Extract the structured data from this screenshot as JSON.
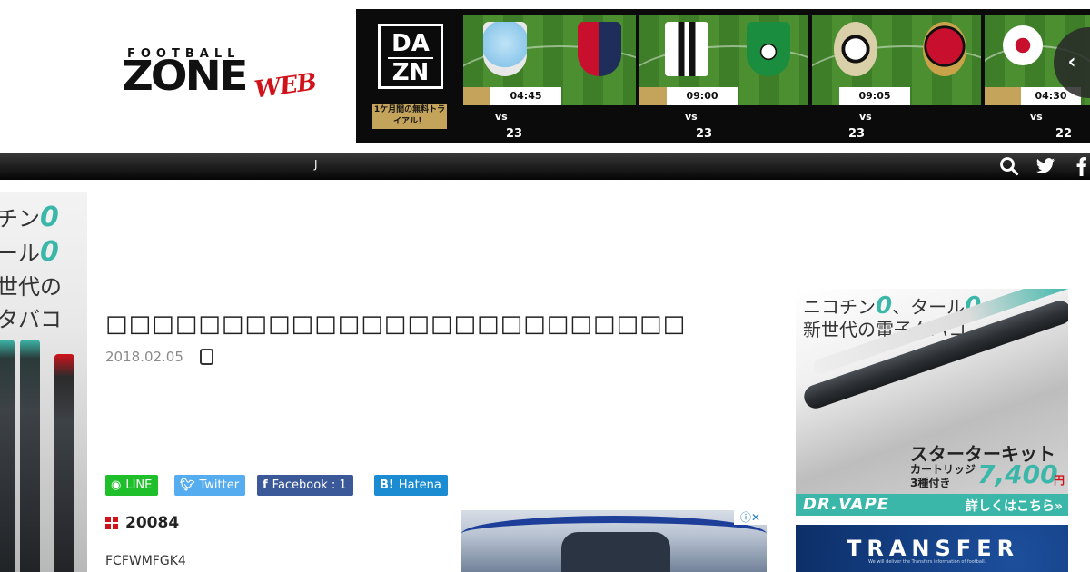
{
  "header": {
    "logo": {
      "top": "FOOTBALL",
      "main": "ZONE",
      "script": "WEB"
    },
    "dazn": {
      "logo_top": "DA",
      "logo_bottom": "ZN",
      "cta": "1ケ月間の無料トライアル！",
      "matches": [
        {
          "time": "04:45",
          "vs": "vs",
          "day": "23",
          "home_crest": "lazio-crest",
          "away_crest": "genoa-crest"
        },
        {
          "time": "09:00",
          "vs": "vs",
          "day": "23",
          "home_crest": "juventus-crest",
          "away_crest": "sassuolo-crest"
        },
        {
          "time": "09:05",
          "vs": "vs",
          "day": "23",
          "home_crest": "udinese-crest",
          "away_crest": "ac-milan-crest"
        },
        {
          "time": "04:30",
          "vs": "vs",
          "day": "22",
          "home_crest": "rb-leipzig-crest",
          "away_crest": ""
        }
      ],
      "prev_icon": "chevron-left-icon"
    }
  },
  "nav": {
    "item_j": "J",
    "icons": [
      "search-icon",
      "twitter-icon",
      "facebook-icon"
    ]
  },
  "left_ad": {
    "line1_text": "チン",
    "line1_zero": "0",
    "line2_text": "ール",
    "line2_zero": "0",
    "line3": "世代の",
    "line4": "タバコ"
  },
  "article": {
    "title": "□□□□□□□□□□□□□□□□□□□□□□□□□□□□□□□□□□□□□□□□□□",
    "date": "2018.02.05",
    "share": {
      "line": "LINE",
      "twitter": "Twitter",
      "facebook": "Facebook : 1",
      "hatena": "Hatena"
    },
    "section_heading": "20084",
    "code": "FCFWMFGK4"
  },
  "right_ad": {
    "copy1_a": "ニコチン",
    "copy1_zero1": "0",
    "copy1_b": "、タール",
    "copy1_zero2": "0",
    "copy2": "新世代の電子タバコ",
    "starter": "スターターキット",
    "cart_line1": "カートリッジ",
    "cart_line2": "3種付き",
    "price": "7,400",
    "yen": "円",
    "brand": "DR.VAPE",
    "detail": "詳しくはこちら»"
  },
  "transfer_ad": {
    "title": "TRANSFER",
    "subtitle": "We will deliver the Transfers information of football."
  },
  "colors": {
    "nav_black": "#050505",
    "accent_red": "#d0121b",
    "teal": "#3bb7a9",
    "line_green": "#1fbe2b",
    "twitter_blue": "#55acee",
    "facebook_blue": "#3b5998",
    "hatena_blue": "#1b8bd2",
    "dazn_gold": "#c4a45a"
  }
}
